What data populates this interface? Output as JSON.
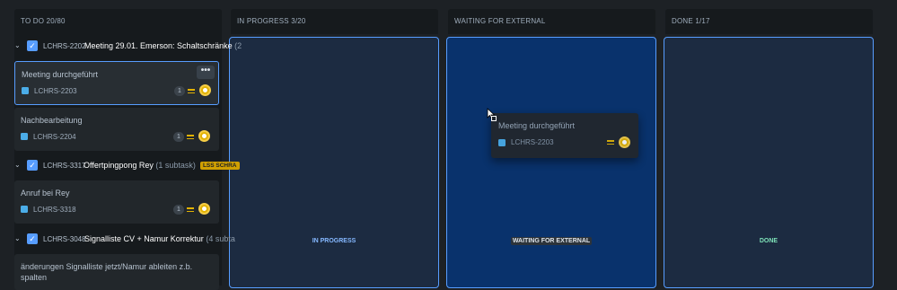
{
  "columns": [
    {
      "header": "TO DO 20/80"
    },
    {
      "header": "IN PROGRESS 3/20",
      "drop_label": "IN PROGRESS"
    },
    {
      "header": "WAITING FOR EXTERNAL",
      "drop_label": "WAITING FOR EXTERNAL"
    },
    {
      "header": "DONE 1/17",
      "drop_label": "DONE"
    }
  ],
  "todo": {
    "parents": [
      {
        "key": "LCHRS-2202",
        "title": "Meeting 29.01. Emerson: Schaltschränke",
        "suffix": "(2"
      },
      {
        "key": "LCHRS-3317",
        "title": "Offertpingpong Rey",
        "suffix": "(1 subtask)",
        "tag": "LSS SCHRA"
      },
      {
        "key": "LCHRS-3048",
        "title": "Signalliste CV + Namur Korrektur",
        "suffix": "(4 subta"
      }
    ],
    "cards": [
      {
        "title": "Meeting durchgeführt",
        "key": "LCHRS-2203",
        "count": "1",
        "more": "•••"
      },
      {
        "title": "Nachbearbeitung",
        "key": "LCHRS-2204",
        "count": "1"
      },
      {
        "title": "Anruf bei Rey",
        "key": "LCHRS-3318",
        "count": "1"
      },
      {
        "title_line1": "änderungen Signalliste jetzt/Namur ableiten z.b.",
        "title_line2": "spalten"
      }
    ]
  },
  "dragging": {
    "title": "Meeting durchgeführt",
    "key": "LCHRS-2203"
  },
  "colors": {
    "accent": "#579dff",
    "priority": "#e2b203",
    "tag": "#cf9f02"
  },
  "icons": [
    "chevron-down-icon",
    "checkbox-icon",
    "subtask-icon",
    "priority-medium-icon",
    "avatar",
    "more-icon",
    "grab-cursor-icon"
  ]
}
